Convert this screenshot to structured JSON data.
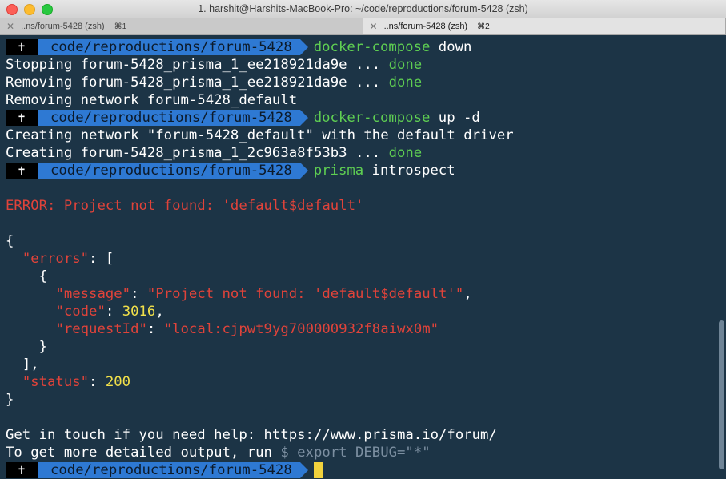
{
  "window": {
    "title": "1. harshit@Harshits-MacBook-Pro: ~/code/reproductions/forum-5428 (zsh)"
  },
  "tabs": [
    {
      "label": "..ns/forum-5428 (zsh)",
      "shortcut": "⌘1",
      "close": "✕"
    },
    {
      "label": "..ns/forum-5428 (zsh)",
      "shortcut": "⌘2",
      "close": "✕"
    }
  ],
  "prompt": {
    "symbol": "✝",
    "path": "code/reproductions/forum-5428"
  },
  "session": {
    "cmd1": {
      "bin": "docker-compose",
      "args": " down"
    },
    "out1": "Stopping forum-5428_prisma_1_ee218921da9e ... ",
    "out2": "Removing forum-5428_prisma_1_ee218921da9e ... ",
    "out3": "Removing network forum-5428_default",
    "done": "done",
    "cmd2": {
      "bin": "docker-compose",
      "args": " up -d"
    },
    "out4": "Creating network \"forum-5428_default\" with the default driver",
    "out5": "Creating forum-5428_prisma_1_2c963a8f53b3 ... ",
    "cmd3": {
      "bin": "prisma",
      "args": " introspect"
    },
    "error": "ERROR: Project not found: 'default$default'",
    "json": {
      "open_brace": "{",
      "errors_key": "\"errors\"",
      "colon": ": ",
      "open_bracket": "[",
      "open_obj": "{",
      "message_key": "\"message\"",
      "message_val": "\"Project not found: 'default$default'\"",
      "code_key": "\"code\"",
      "code_val": "3016",
      "requestId_key": "\"requestId\"",
      "requestId_val": "\"local:cjpwt9yg700000932f8aiwx0m\"",
      "close_obj": "}",
      "close_bracket": "],",
      "status_key": "\"status\"",
      "status_val": "200",
      "close_brace": "}",
      "comma": ","
    },
    "help": "Get in touch if you need help: https://www.prisma.io/forum/",
    "debug_prefix": "To get more detailed output, run ",
    "debug_cmd": "$ export DEBUG=\"*\""
  },
  "colors": {
    "background": "#1c3446",
    "prompt_path_bg": "#2e79d3",
    "command": "#5fcf52",
    "error": "#e0433a",
    "number": "#f1e04a",
    "cursor": "#f1d23d"
  }
}
